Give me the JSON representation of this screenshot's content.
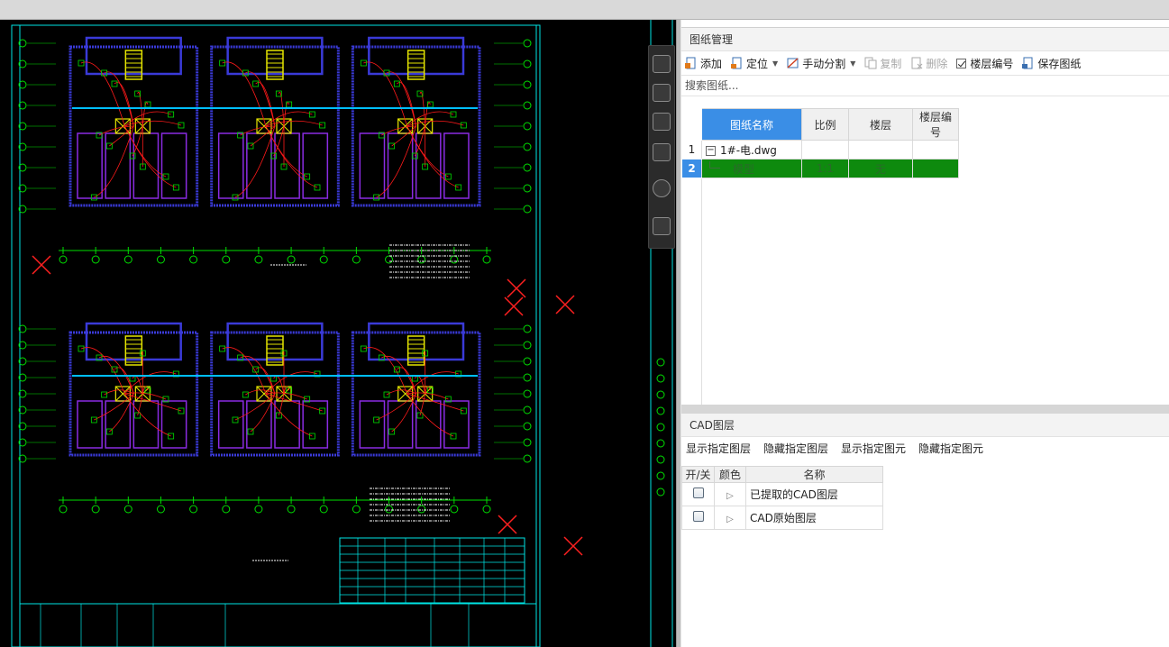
{
  "canvas": {
    "background": "#000000",
    "colors": {
      "wall": "#3a3ad8",
      "wall_inner": "#8a2be2",
      "wire": "#ff1a1a",
      "device": "#00e000",
      "frame": "#00e5e5",
      "text": "#ffffff",
      "stair": "#e6e600",
      "marker": "#ff2020"
    }
  },
  "drawing_panel": {
    "title": "图纸管理",
    "toolbar": {
      "add": "添加",
      "locate": "定位",
      "manual_split": "手动分割",
      "copy": "复制",
      "delete": "删除",
      "floor_number_checked": true,
      "floor_number": "楼层编号",
      "save": "保存图纸"
    },
    "search_placeholder": "搜索图纸...",
    "columns": [
      "图纸名称",
      "比例",
      "楼层",
      "楼层编号"
    ],
    "rows": [
      {
        "num": "1",
        "name": "1#-电.dwg",
        "scale": "",
        "floor": "",
        "floor_no": ""
      },
      {
        "num": "2",
        "name": "模型",
        "scale": "1:1",
        "floor": "无",
        "floor_no": ""
      }
    ]
  },
  "cad_layer_panel": {
    "title": "CAD图层",
    "actions": [
      "显示指定图层",
      "隐藏指定图层",
      "显示指定图元",
      "隐藏指定图元"
    ],
    "columns": [
      "开/关",
      "颜色",
      "名称"
    ],
    "rows": [
      {
        "name": "已提取的CAD图层"
      },
      {
        "name": "CAD原始图层"
      }
    ]
  }
}
